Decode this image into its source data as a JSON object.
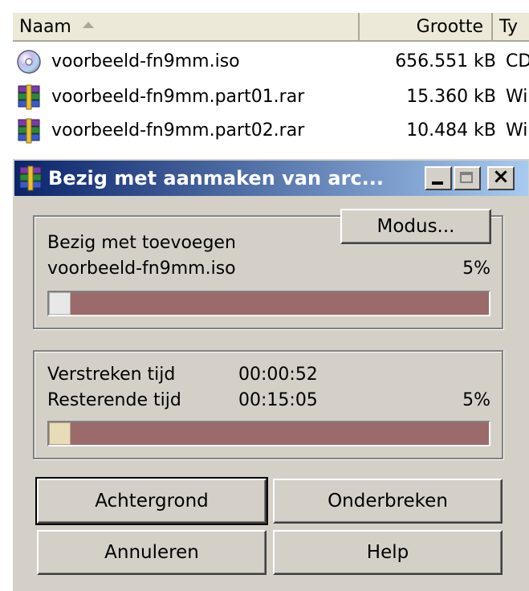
{
  "explorer": {
    "columns": {
      "name": "Naam",
      "size": "Grootte",
      "type": "Ty"
    },
    "files": [
      {
        "name": "voorbeeld-fn9mm.iso",
        "size": "656.551 kB",
        "type": "CD",
        "icon": "cd-disc-icon"
      },
      {
        "name": "voorbeeld-fn9mm.part01.rar",
        "size": "15.360 kB",
        "type": "Wi",
        "icon": "winrar-archive-icon"
      },
      {
        "name": "voorbeeld-fn9mm.part02.rar",
        "size": "10.484 kB",
        "type": "Wi",
        "icon": "winrar-archive-icon"
      }
    ]
  },
  "dialog": {
    "title": "Bezig met aanmaken van arc...",
    "modus_button": "Modus...",
    "action_label": "Bezig met toevoegen",
    "current_file": "voorbeeld-fn9mm.iso",
    "file_percent": "5%",
    "file_progress": 0.05,
    "elapsed_label": "Verstreken tijd",
    "elapsed_value": "00:00:52",
    "remaining_label": "Resterende tijd",
    "remaining_value": "00:15:05",
    "total_percent": "5%",
    "total_progress": 0.05,
    "buttons": {
      "background": "Achtergrond",
      "pause": "Onderbreken",
      "cancel": "Annuleren",
      "help": "Help"
    }
  },
  "colors": {
    "titlebar_start": "#0a246a",
    "titlebar_end": "#a6caf0",
    "dialog_bg": "#d4d0c8",
    "progress_track": "#9b6b6b"
  }
}
